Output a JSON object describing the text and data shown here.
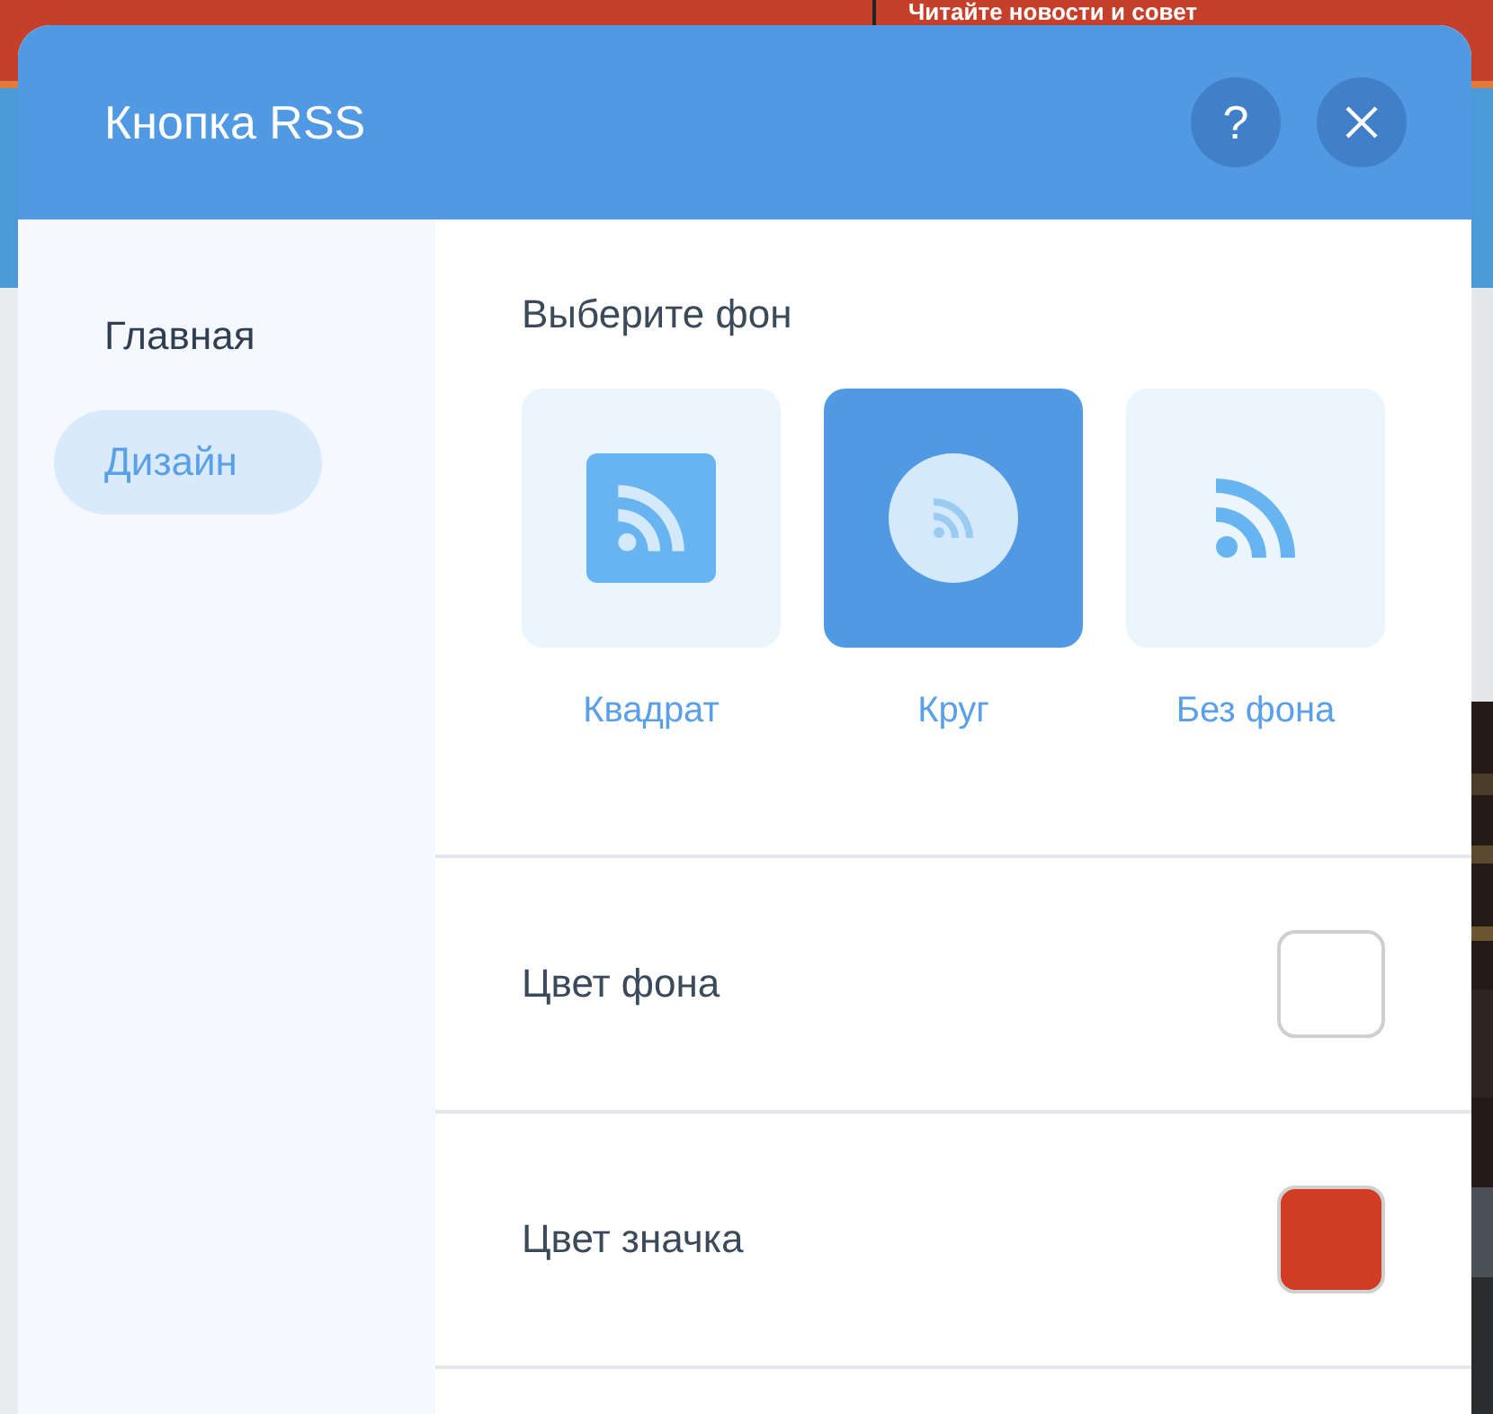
{
  "background_page": {
    "headline": "Читайте новости и совет"
  },
  "dialog": {
    "title": "Кнопка RSS",
    "help_button": "?"
  },
  "sidebar": {
    "items": [
      {
        "label": "Главная",
        "selected": false
      },
      {
        "label": "Дизайн",
        "selected": true
      }
    ]
  },
  "background_picker": {
    "title": "Выберите фон",
    "options": [
      {
        "label": "Квадрат",
        "kind": "square",
        "selected": false
      },
      {
        "label": "Круг",
        "kind": "circle",
        "selected": true
      },
      {
        "label": "Без фона",
        "kind": "plain",
        "selected": false
      }
    ]
  },
  "color_rows": [
    {
      "label": "Цвет фона",
      "color": "#ffffff"
    },
    {
      "label": "Цвет значка",
      "color": "#d03c24"
    }
  ]
}
